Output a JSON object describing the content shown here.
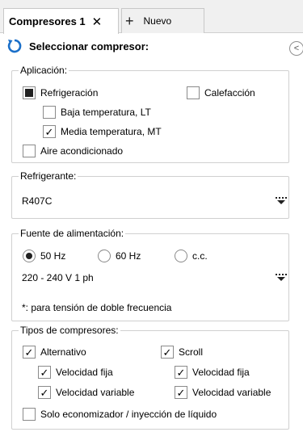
{
  "tabs": {
    "active_label": "Compresores 1",
    "close_glyph": "✕",
    "add_glyph": "+",
    "new_label": "Nuevo"
  },
  "header": {
    "title": "Seleccionar compresor:",
    "collapse_glyph": "<",
    "accent_color": "#1a6fc9"
  },
  "aplicacion": {
    "legend": "Aplicación:",
    "refrigeracion": {
      "label": "Refrigeración",
      "state": "indeterminate"
    },
    "calefaccion": {
      "label": "Calefacción",
      "checked": false
    },
    "baja": {
      "label": "Baja temperatura, LT",
      "checked": false
    },
    "media": {
      "label": "Media temperatura, MT",
      "checked": true
    },
    "aire": {
      "label": "Aire acondicionado",
      "checked": false
    }
  },
  "refrigerante": {
    "legend": "Refrigerante:",
    "value": "R407C"
  },
  "fuente": {
    "legend": "Fuente de alimentación:",
    "options": [
      {
        "label": "50 Hz",
        "selected": true
      },
      {
        "label": "60 Hz",
        "selected": false
      },
      {
        "label": "c.c.",
        "selected": false
      }
    ],
    "voltage_value": "220 - 240 V 1 ph",
    "note": "*: para tensión de doble frecuencia"
  },
  "tipos": {
    "legend": "Tipos de compresores:",
    "alternativo": {
      "label": "Alternativo",
      "checked": true
    },
    "scroll": {
      "label": "Scroll",
      "checked": true
    },
    "alt_fija": {
      "label": "Velocidad fija",
      "checked": true
    },
    "alt_variable": {
      "label": "Velocidad variable",
      "checked": true
    },
    "scr_fija": {
      "label": "Velocidad fija",
      "checked": true
    },
    "scr_variable": {
      "label": "Velocidad variable",
      "checked": true
    },
    "economizador": {
      "label": "Solo economizador / inyección de líquido",
      "checked": false
    }
  }
}
